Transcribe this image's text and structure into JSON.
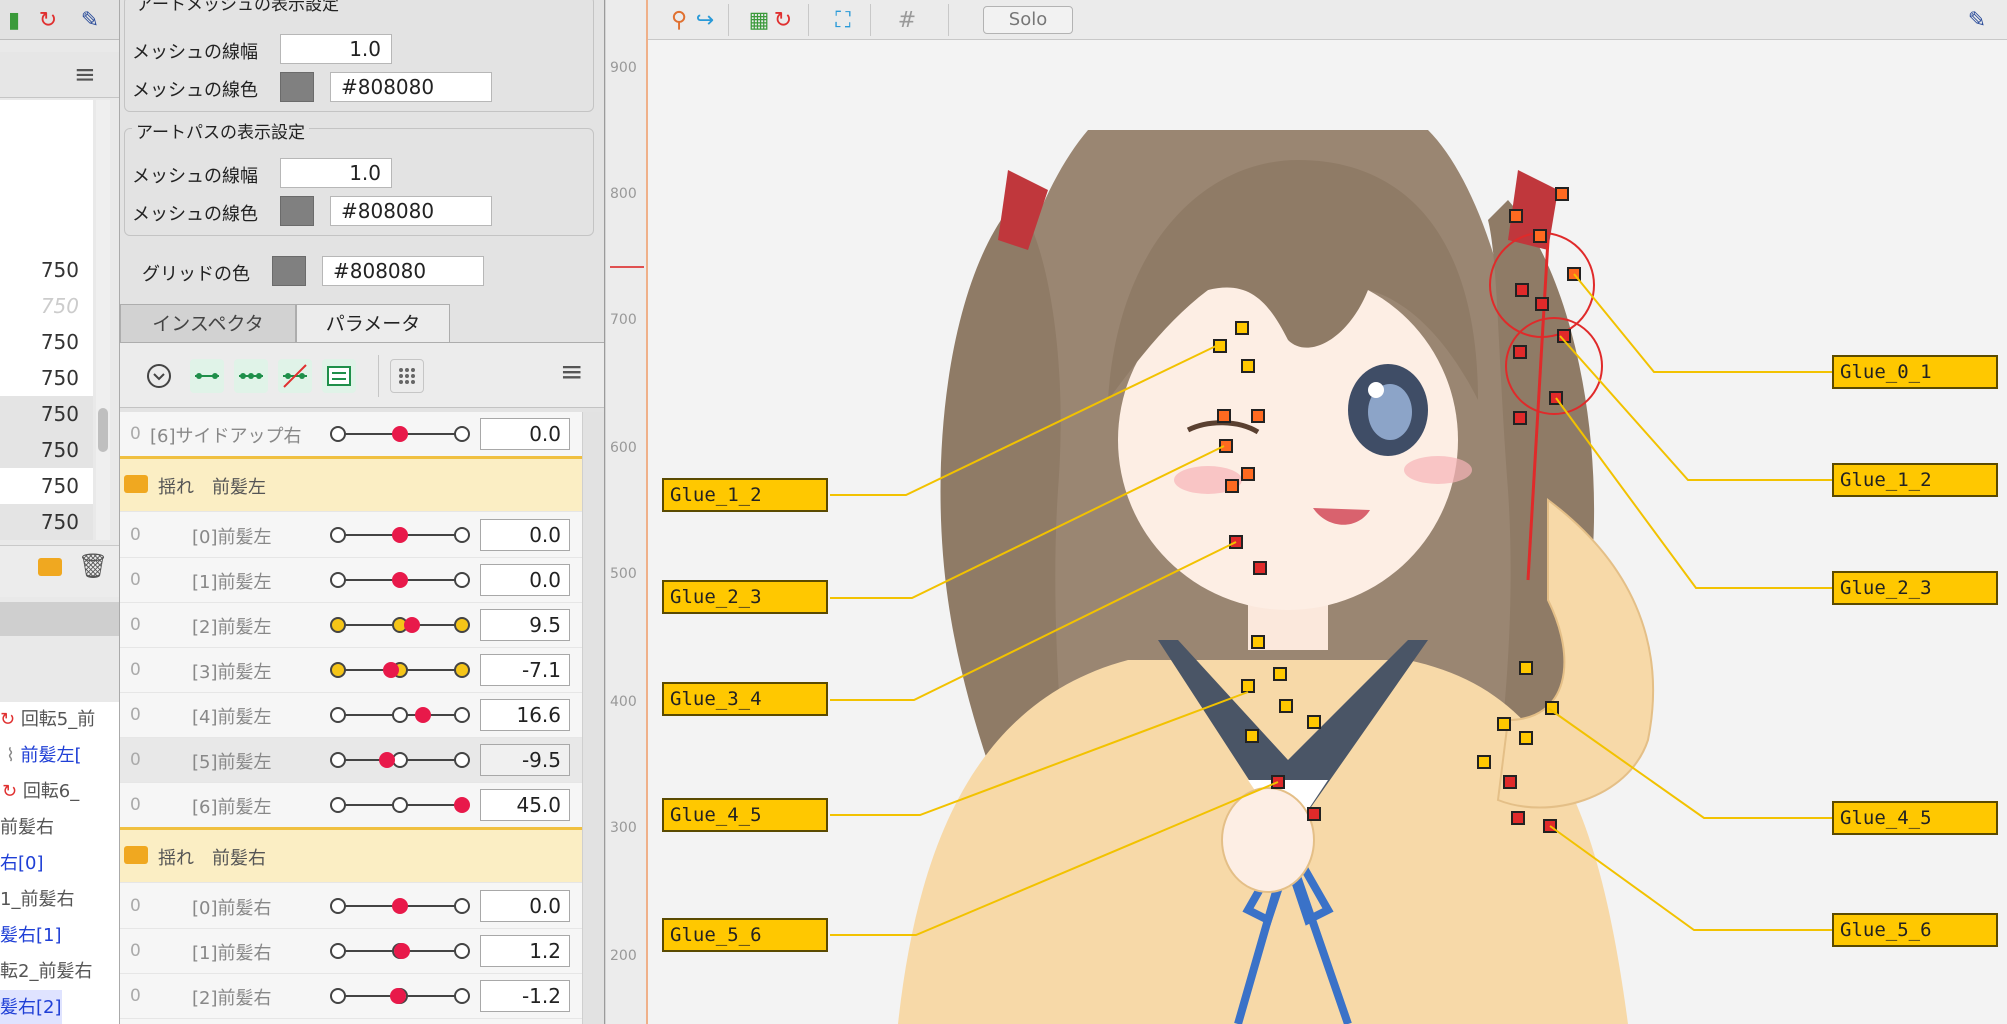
{
  "settings": {
    "artmesh_group_title": "アートメッシュの表示設定",
    "artpath_group_title": "アートパスの表示設定",
    "line_width_label": "メッシュの線幅",
    "line_color_label": "メッシュの線色",
    "artmesh_line_width": "1.0",
    "artmesh_line_color": "#808080",
    "artpath_line_width": "1.0",
    "artpath_line_color": "#808080",
    "grid_color_label": "グリッドの色",
    "grid_color": "#808080"
  },
  "tabs": {
    "inspector": "インスペクタ",
    "parameters": "パラメータ"
  },
  "params": {
    "top_row": {
      "key": "0",
      "name": "[6]サイドアップ右",
      "value": "0.0"
    },
    "folder_left": "揺れ　前髪左",
    "left_rows": [
      {
        "key": "0",
        "name": "[0]前髪左",
        "value": "0.0"
      },
      {
        "key": "0",
        "name": "[1]前髪左",
        "value": "0.0"
      },
      {
        "key": "0",
        "name": "[2]前髪左",
        "value": "9.5"
      },
      {
        "key": "0",
        "name": "[3]前髪左",
        "value": "-7.1"
      },
      {
        "key": "0",
        "name": "[4]前髪左",
        "value": "16.6"
      },
      {
        "key": "0",
        "name": "[5]前髪左",
        "value": "-9.5"
      },
      {
        "key": "0",
        "name": "[6]前髪左",
        "value": "45.0"
      }
    ],
    "folder_right": "揺れ　前髪右",
    "right_rows": [
      {
        "key": "0",
        "name": "[0]前髪右",
        "value": "0.0"
      },
      {
        "key": "0",
        "name": "[1]前髪右",
        "value": "1.2"
      },
      {
        "key": "0",
        "name": "[2]前髪右",
        "value": "-1.2"
      }
    ]
  },
  "left_list": {
    "values": [
      "750",
      "750",
      "750",
      "750",
      "750",
      "750",
      "750",
      "750"
    ]
  },
  "left_tree": {
    "rows": [
      "回転5_前",
      "前髪左[",
      "回転6_",
      "前髪右",
      "右[0]",
      "1_前髪右",
      "髪右[1]",
      "転2_前髪右",
      "髪右[2]"
    ]
  },
  "ruler": {
    "labels": [
      "900",
      "800",
      "700",
      "600",
      "500",
      "400",
      "300",
      "200"
    ]
  },
  "viewport": {
    "solo_label": "Solo",
    "glue_left": [
      "Glue_1_2",
      "Glue_2_3",
      "Glue_3_4",
      "Glue_4_5",
      "Glue_5_6"
    ],
    "glue_right": [
      "Glue_0_1",
      "Glue_1_2",
      "Glue_2_3",
      "Glue_4_5",
      "Glue_5_6"
    ]
  },
  "colors": {
    "glue_label_bg": "#ffc800",
    "glue_line": "#f2c200",
    "param_dot": "#e8194a",
    "keyframe": "#f5c518",
    "folder_highlight": "#fbeec4"
  }
}
